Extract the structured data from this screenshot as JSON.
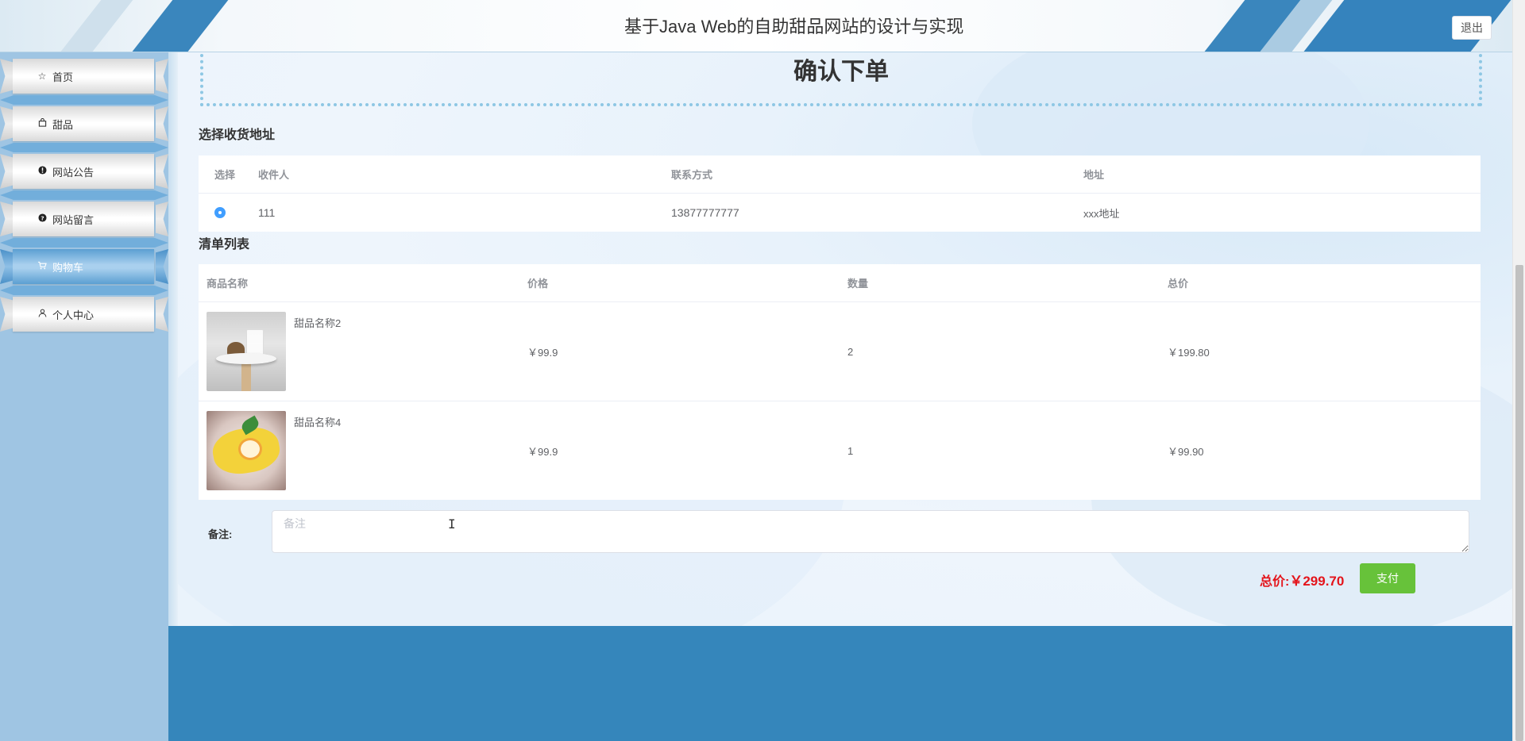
{
  "header": {
    "title": "基于Java Web的自助甜品网站的设计与实现",
    "logout_label": "退出"
  },
  "sidebar": {
    "items": [
      {
        "label": "首页",
        "icon": "star-icon",
        "active": false
      },
      {
        "label": "甜品",
        "icon": "bag-icon",
        "active": false
      },
      {
        "label": "网站公告",
        "icon": "alert-icon",
        "active": false
      },
      {
        "label": "网站留言",
        "icon": "question-icon",
        "active": false
      },
      {
        "label": "购物车",
        "icon": "cart-icon",
        "active": true
      },
      {
        "label": "个人中心",
        "icon": "user-icon",
        "active": false
      }
    ]
  },
  "main": {
    "page_title": "确认下单",
    "address_section": {
      "label": "选择收货地址",
      "headers": {
        "select": "选择",
        "recipient": "收件人",
        "contact": "联系方式",
        "address": "地址"
      },
      "rows": [
        {
          "selected": true,
          "recipient": "111",
          "contact": "13877777777",
          "address": "xxx地址"
        }
      ]
    },
    "order_section": {
      "label": "清单列表",
      "headers": {
        "name": "商品名称",
        "price": "价格",
        "quantity": "数量",
        "total": "总价"
      },
      "rows": [
        {
          "name": "甜品名称2",
          "price": "￥99.9",
          "quantity": "2",
          "total": "￥199.80"
        },
        {
          "name": "甜品名称4",
          "price": "￥99.9",
          "quantity": "1",
          "total": "￥99.90"
        }
      ]
    },
    "remark": {
      "label": "备注:",
      "placeholder": "备注",
      "value": ""
    },
    "summary": {
      "total_label": "总价:",
      "total_amount": "￥299.70",
      "pay_label": "支付"
    }
  },
  "colors": {
    "accent": "#409eff",
    "pay_button": "#67c23a",
    "total_text": "#e4141b",
    "header_stripe": "#3a86bd",
    "sidebar_bg": "#9fc5e3"
  }
}
